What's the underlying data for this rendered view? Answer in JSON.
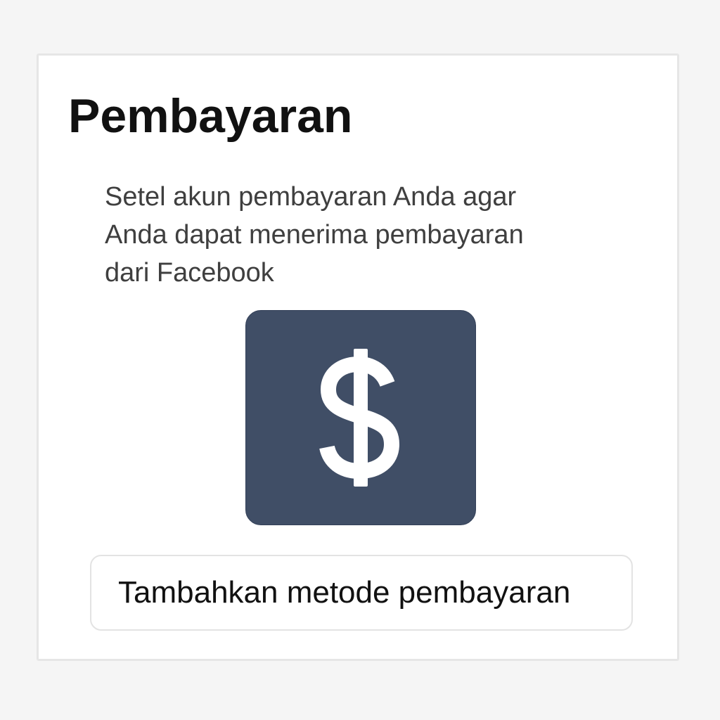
{
  "payment": {
    "title": "Pembayaran",
    "description_lines": [
      "Setel akun pembayaran Anda agar",
      "Anda dapat menerima pembayaran",
      "dari Facebook"
    ],
    "icon": "dollar-sign-icon",
    "icon_bg_color": "#404e66",
    "icon_glyph_color": "#ffffff",
    "add_button_label": "Tambahkan metode pembayaran"
  }
}
